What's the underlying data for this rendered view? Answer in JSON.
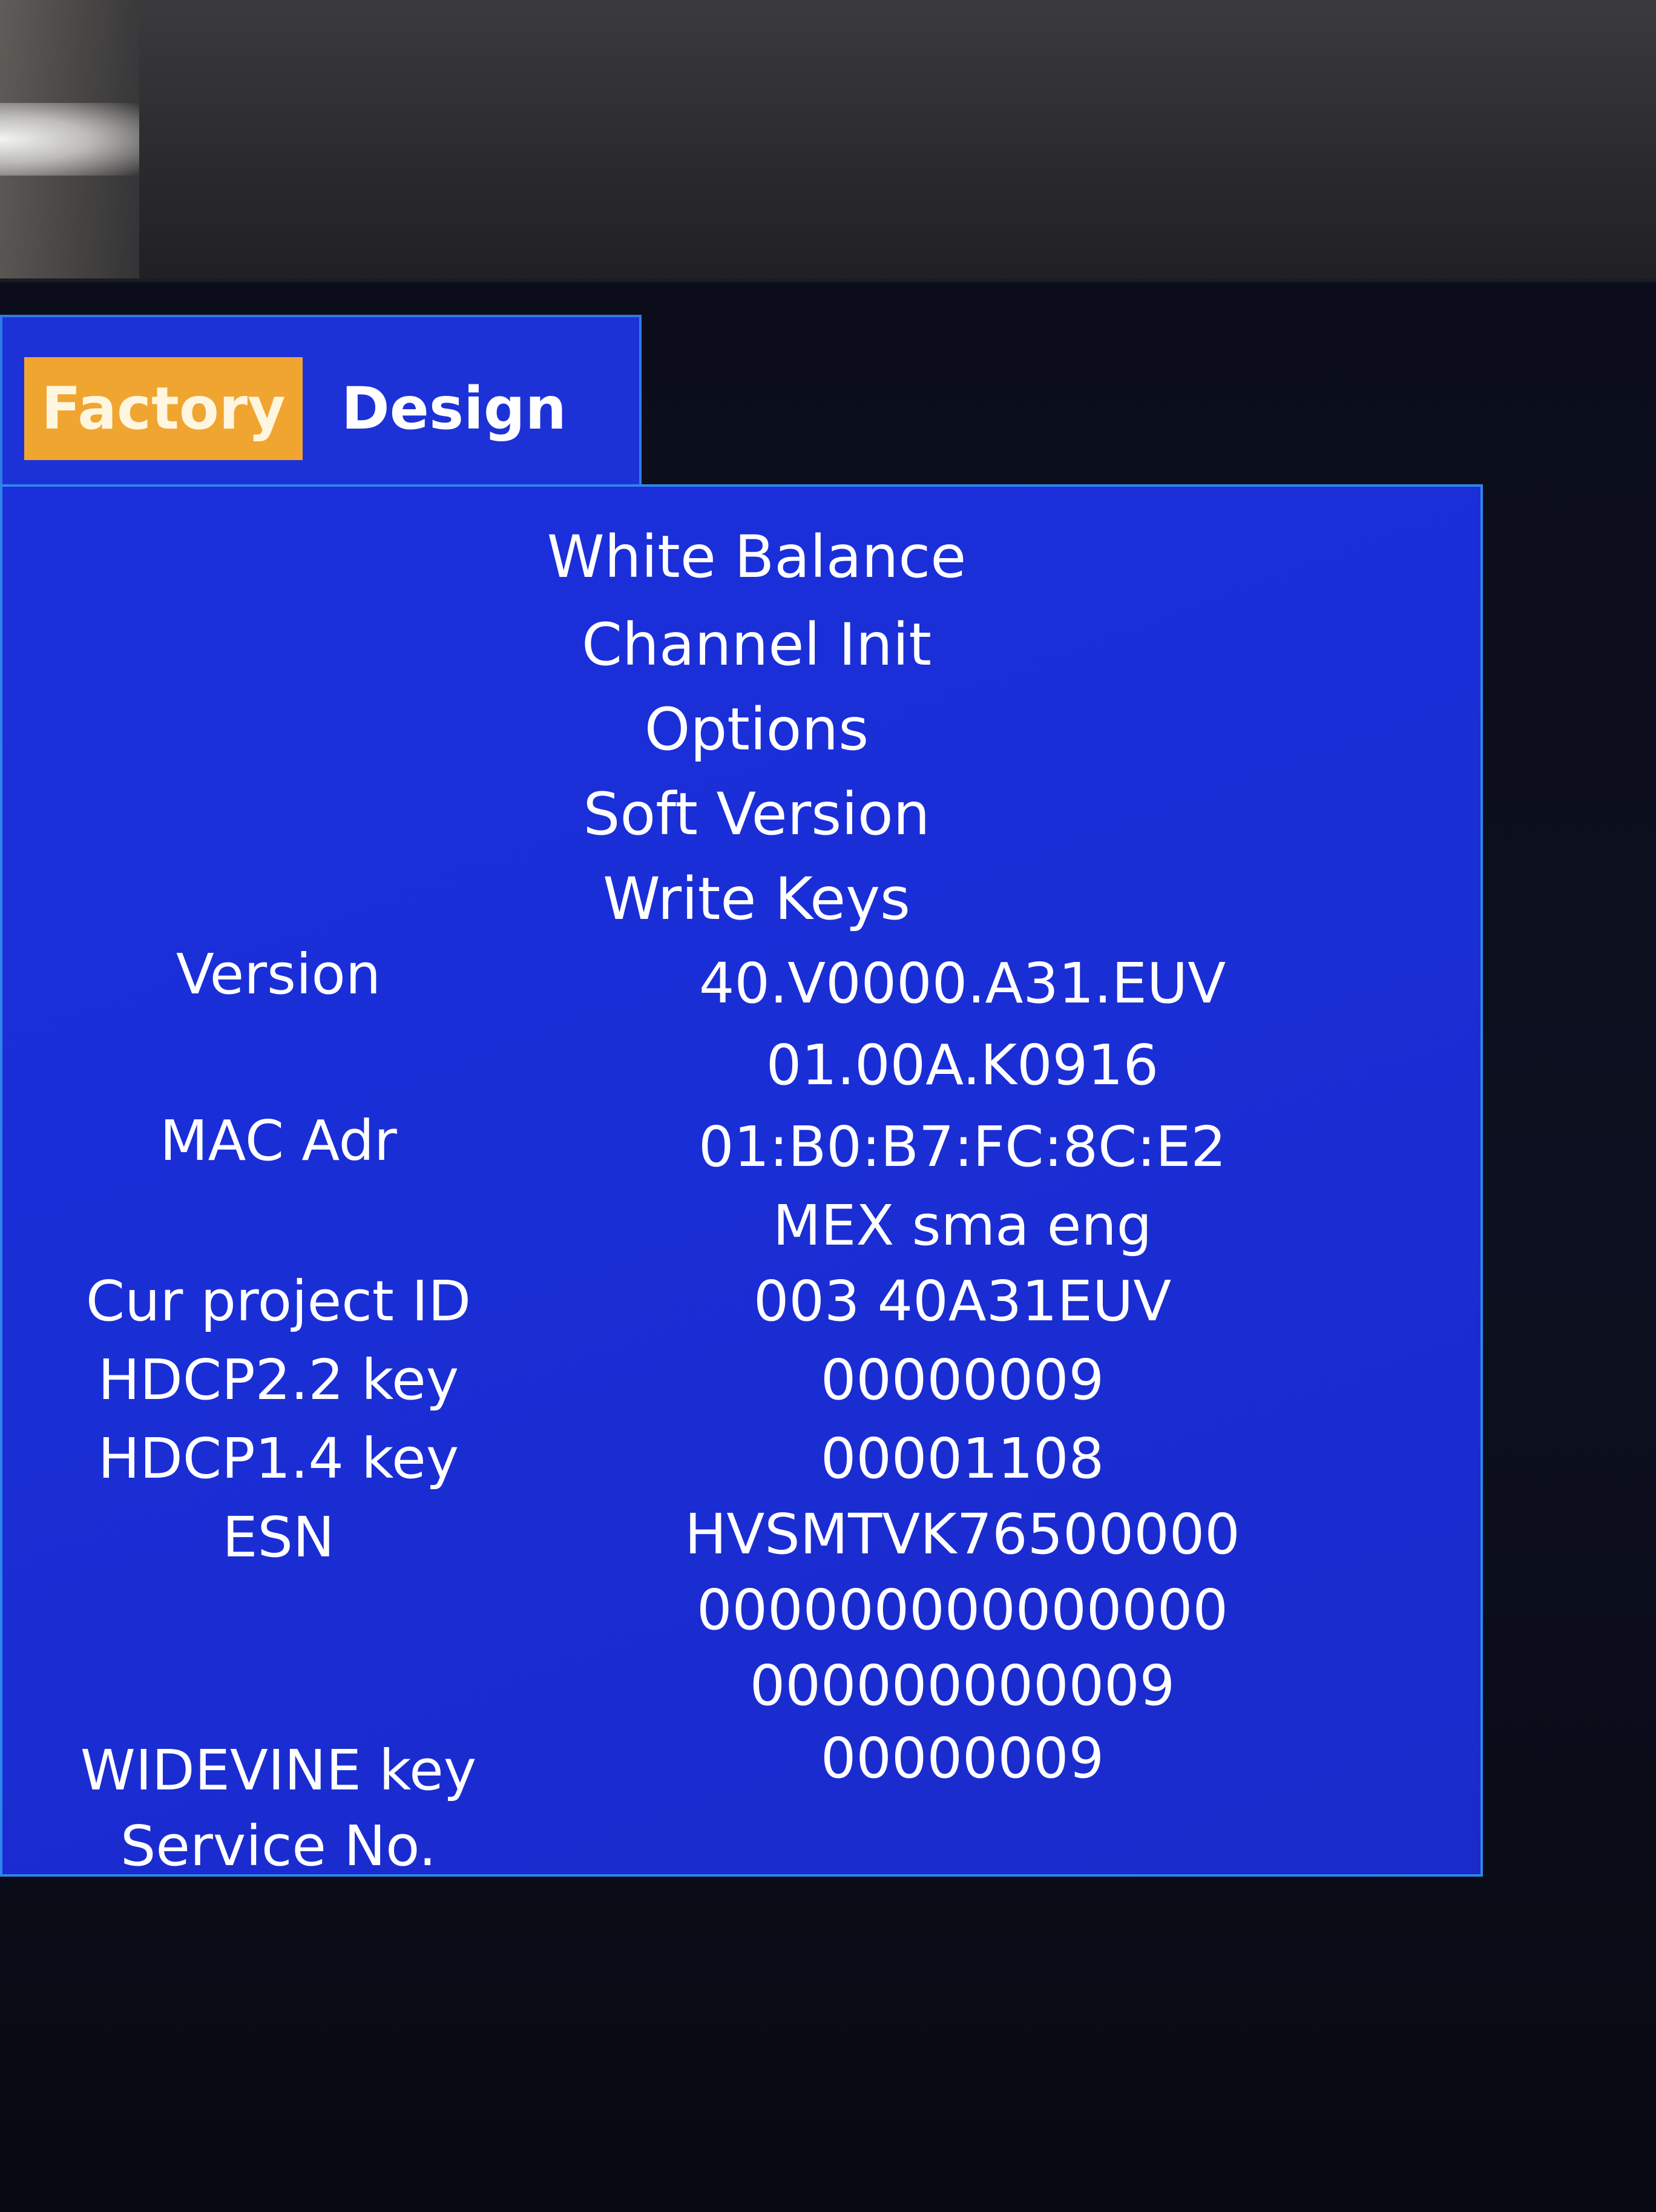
{
  "tabs": {
    "factory": "Factory",
    "design": "Design"
  },
  "menu": {
    "items": [
      {
        "label": "White Balance"
      },
      {
        "label": "Channel Init"
      },
      {
        "label": "Options"
      },
      {
        "label": "Soft Version"
      },
      {
        "label": "Write Keys"
      }
    ]
  },
  "info": {
    "version_label": "Version",
    "version_value": "40.V0000.A31.EUV",
    "version_sub": "01.00A.K0916",
    "mac_label": "MAC Adr",
    "mac_value": "01:B0:B7:FC:8C:E2",
    "mac_sub": "MEX sma eng",
    "project_label": "Cur project ID",
    "project_value": "003 40A31EUV",
    "hdcp22_label": "HDCP2.2 key",
    "hdcp22_value": "00000009",
    "hdcp14_label": "HDCP1.4 key",
    "hdcp14_value": "00001108",
    "esn_label": "ESN",
    "esn_value": "HVSMTVK76500000",
    "esn_line2": "000000000000000",
    "esn_line3": "000000000009",
    "widevine_label": "WIDEVINE key",
    "widevine_value": "00000009",
    "service_label": "Service No."
  },
  "colors": {
    "panel_blue": "#1b30db",
    "panel_border": "#2f86ea",
    "tab_selected": "#f0a531",
    "text": "#ffffff"
  }
}
